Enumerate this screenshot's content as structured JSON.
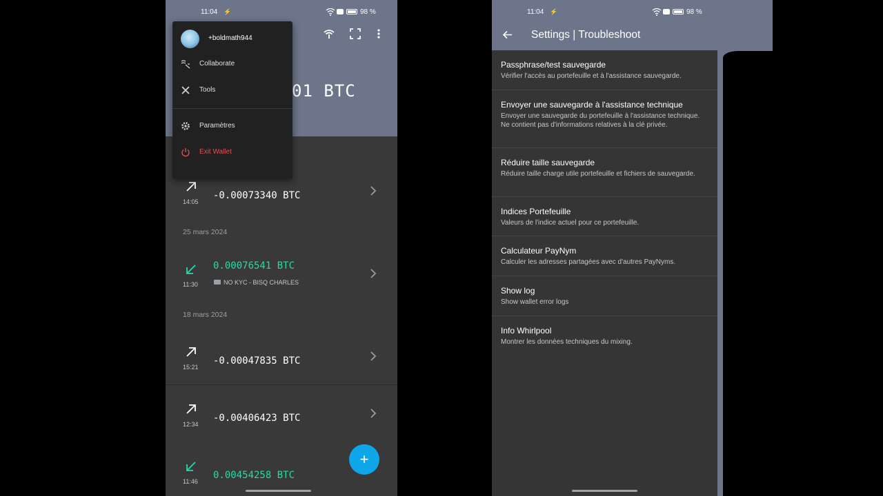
{
  "colors": {
    "screen_bg": "#6c7589",
    "list_bg": "#393939",
    "menu_bg": "#212121",
    "fab": "#0ea5e9",
    "incoming": "#2bd8a8",
    "exit_red": "#e05555",
    "settings_bg": "#353535"
  },
  "left": {
    "status": {
      "time": "11:04",
      "right_text": "98 %"
    },
    "balance_partial": "01 BTC",
    "menu": {
      "username": "+boldmath944",
      "items": [
        {
          "label": "Collaborate",
          "icon": "collaborate-icon"
        },
        {
          "label": "Tools",
          "icon": "tools-icon"
        },
        {
          "label": "Paramètres",
          "icon": "gear-icon"
        },
        {
          "label": "Exit Wallet",
          "icon": "power-icon"
        }
      ]
    },
    "transactions": [
      {
        "amount": "-0.00073340 BTC",
        "time": "14:05",
        "direction": "out"
      },
      {
        "amount": "0.00076541 BTC",
        "time": "11:30",
        "direction": "in",
        "label": "NO KYC - BISQ CHARLES"
      },
      {
        "amount": "-0.00047835 BTC",
        "time": "15:21",
        "direction": "out"
      },
      {
        "amount": "-0.00406423 BTC",
        "time": "12:34",
        "direction": "out"
      },
      {
        "amount": "0.00454258 BTC",
        "time": "11:46",
        "direction": "in"
      }
    ],
    "dates": [
      "25 mars 2024",
      "18 mars 2024"
    ],
    "fab_label": "+"
  },
  "right": {
    "status": {
      "time": "11:04",
      "right_text": "98 %"
    },
    "title": "Settings | Troubleshoot",
    "items": [
      {
        "title": "Passphrase/test sauvegarde",
        "subtitle": "Vérifier l'accès au portefeuille et à l'assistance sauvegarde."
      },
      {
        "title": "Envoyer une sauvegarde à l'assistance technique",
        "subtitle": "Envoyer une sauvegarde du portefeuille à l'assistance technique. Ne contient pas d'informations relatives à la clé privée."
      },
      {
        "title": "Réduire taille sauvegarde",
        "subtitle": "Réduire taille charge utile portefeuille et fichiers de sauvegarde."
      },
      {
        "title": "Indices Portefeuille",
        "subtitle": "Valeurs de l'indice actuel pour ce portefeuille."
      },
      {
        "title": "Calculateur PayNym",
        "subtitle": "Calculer les adresses partagées avec d'autres PayNyms."
      },
      {
        "title": "Show log",
        "subtitle": "Show wallet error logs"
      },
      {
        "title": "Info Whirlpool",
        "subtitle": "Montrer les données techniques du mixing."
      }
    ]
  }
}
